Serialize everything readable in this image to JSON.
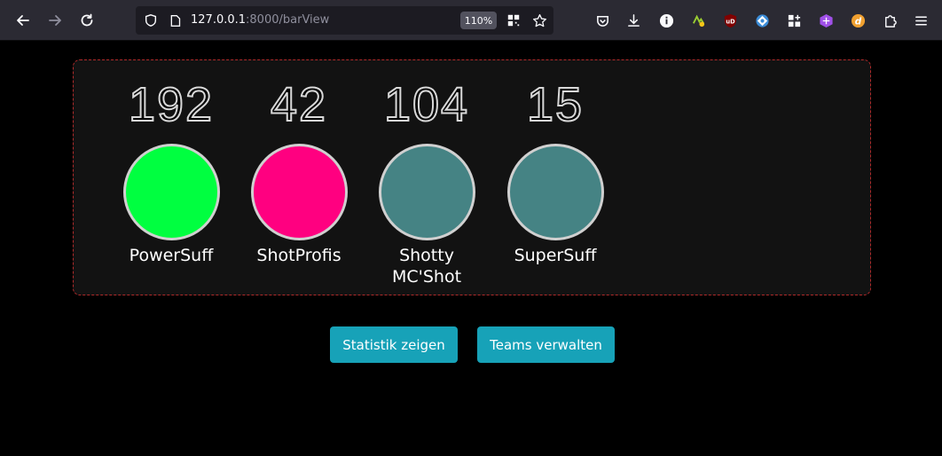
{
  "browser": {
    "url_host": "127.0.0.1",
    "url_rest": ":8000/barView",
    "zoom": "110%",
    "extensions": [
      {
        "icon": "pocket-icon"
      },
      {
        "icon": "download-icon"
      },
      {
        "icon": "info-circle-icon"
      },
      {
        "icon": "grammar-checker-icon"
      },
      {
        "icon": "ublock-origin-icon",
        "label": "uD"
      },
      {
        "icon": "dark-reader-icon"
      },
      {
        "icon": "add-extension-icon"
      },
      {
        "icon": "tor-onion-icon"
      },
      {
        "icon": "d-extension-icon",
        "label": "d"
      },
      {
        "icon": "puzzle-icon"
      },
      {
        "icon": "hamburger-menu-icon"
      }
    ]
  },
  "teams": [
    {
      "score": "192",
      "name": "PowerSuff",
      "color": "#00ff40"
    },
    {
      "score": "42",
      "name": "ShotProfis",
      "color": "#ff0080"
    },
    {
      "score": "104",
      "name": "Shotty MC'Shot",
      "color": "#458384"
    },
    {
      "score": "15",
      "name": "SuperSuff",
      "color": "#458384"
    }
  ],
  "buttons": {
    "stats_label": "Statistik zeigen",
    "teams_label": "Teams verwalten",
    "color": "#17a2b8"
  }
}
